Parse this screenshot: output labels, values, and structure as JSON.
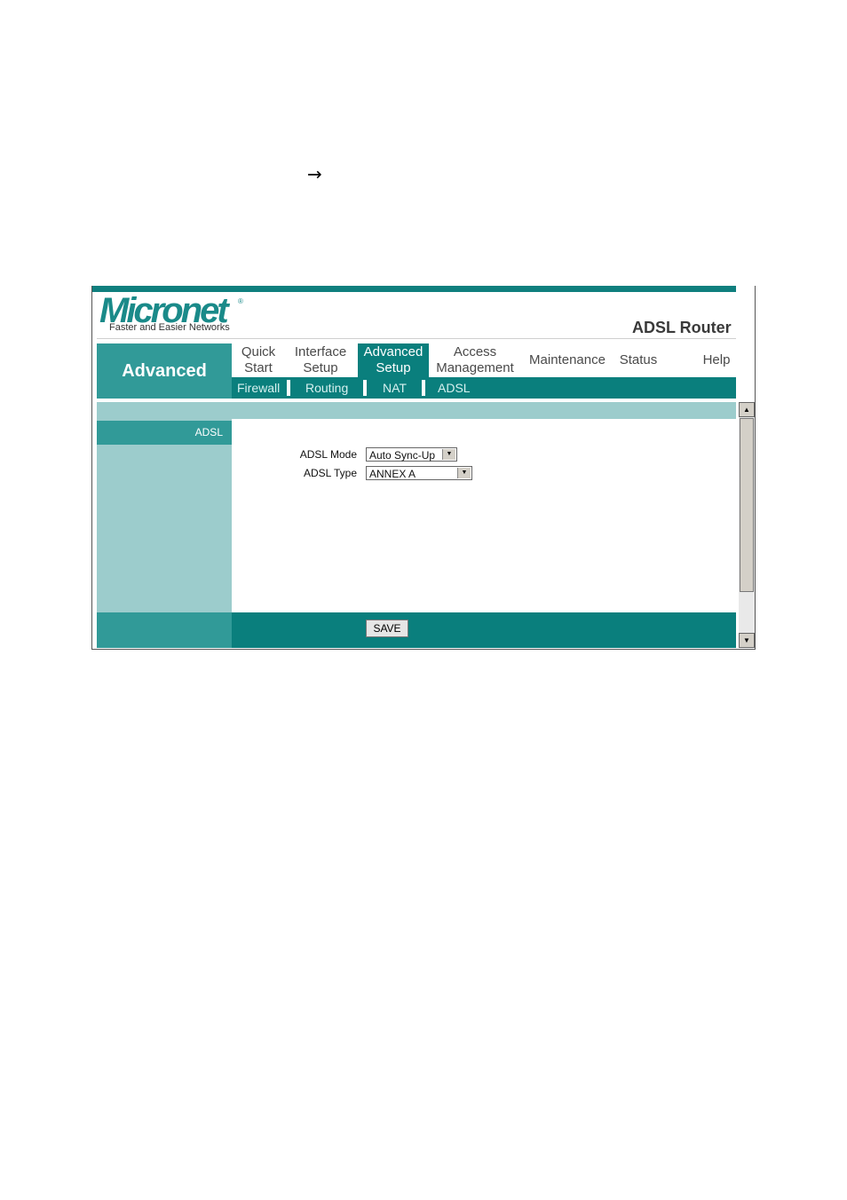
{
  "page": {
    "arrow": "→"
  },
  "brand": {
    "logo": "Micronet",
    "registered": "®",
    "tagline": "Faster and Easier Networks",
    "product": "ADSL Router"
  },
  "section_title": "Advanced",
  "nav": {
    "quick_start": [
      "Quick",
      "Start"
    ],
    "interface_setup": [
      "Interface",
      "Setup"
    ],
    "advanced_setup": [
      "Advanced",
      "Setup"
    ],
    "access_management": [
      "Access",
      "Management"
    ],
    "maintenance": "Maintenance",
    "status": "Status",
    "help": "Help"
  },
  "subnav": {
    "firewall": "Firewall",
    "routing": "Routing",
    "nat": "NAT",
    "adsl": "ADSL"
  },
  "sidebar": {
    "heading": "ADSL"
  },
  "form": {
    "adsl_mode": {
      "label": "ADSL Mode",
      "value": "Auto Sync-Up"
    },
    "adsl_type": {
      "label": "ADSL Type",
      "value": "ANNEX A"
    }
  },
  "actions": {
    "save": "SAVE"
  },
  "icons": {
    "up": "▲",
    "down": "▼",
    "dropdown": "▼"
  },
  "colors": {
    "teal_dark": "#0a7f7d",
    "teal_mid": "#319a98",
    "teal_light": "#9ccccc"
  }
}
